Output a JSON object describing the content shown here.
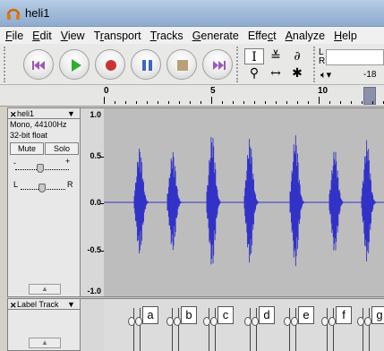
{
  "window": {
    "title": "heli1"
  },
  "menu": [
    {
      "pre": "",
      "ul": "F",
      "post": "ile"
    },
    {
      "pre": "",
      "ul": "E",
      "post": "dit"
    },
    {
      "pre": "",
      "ul": "V",
      "post": "iew"
    },
    {
      "pre": "T",
      "ul": "r",
      "post": "ansport"
    },
    {
      "pre": "",
      "ul": "T",
      "post": "racks"
    },
    {
      "pre": "",
      "ul": "G",
      "post": "enerate"
    },
    {
      "pre": "Effe",
      "ul": "c",
      "post": "t"
    },
    {
      "pre": "",
      "ul": "A",
      "post": "nalyze"
    },
    {
      "pre": "",
      "ul": "H",
      "post": "elp"
    }
  ],
  "transport": {
    "colors": {
      "skip": "#9b59b6",
      "play": "#2eae2e",
      "record": "#cc3333",
      "pause": "#3b66c8",
      "stop": "#b9a07a"
    },
    "icons": [
      "skip-start-icon",
      "play-icon",
      "record-icon",
      "pause-icon",
      "stop-icon",
      "skip-end-icon"
    ]
  },
  "tools": {
    "selection": "I",
    "envelope": "≚",
    "draw": "∂",
    "zoom": "⚲",
    "timeshift": "↔",
    "multi": "✱"
  },
  "meter": {
    "left": "L",
    "right": "R",
    "value": "-18"
  },
  "ruler": {
    "labels": [
      "0",
      "5",
      "10"
    ]
  },
  "audio_track": {
    "name": "heli1",
    "info1": "Mono, 44100Hz",
    "info2": "32-bit float",
    "mute": "Mute",
    "solo": "Solo",
    "gain_minus": "-",
    "gain_plus": "+",
    "pan_left": "L",
    "pan_right": "R",
    "scale": [
      "1.0",
      "0.5",
      "0.0",
      "-0.5",
      "-1.0"
    ],
    "wave_color": "#3232c8"
  },
  "label_track": {
    "name": "Label Track",
    "labels": [
      "a",
      "b",
      "c",
      "d",
      "e",
      "f",
      "g"
    ]
  }
}
